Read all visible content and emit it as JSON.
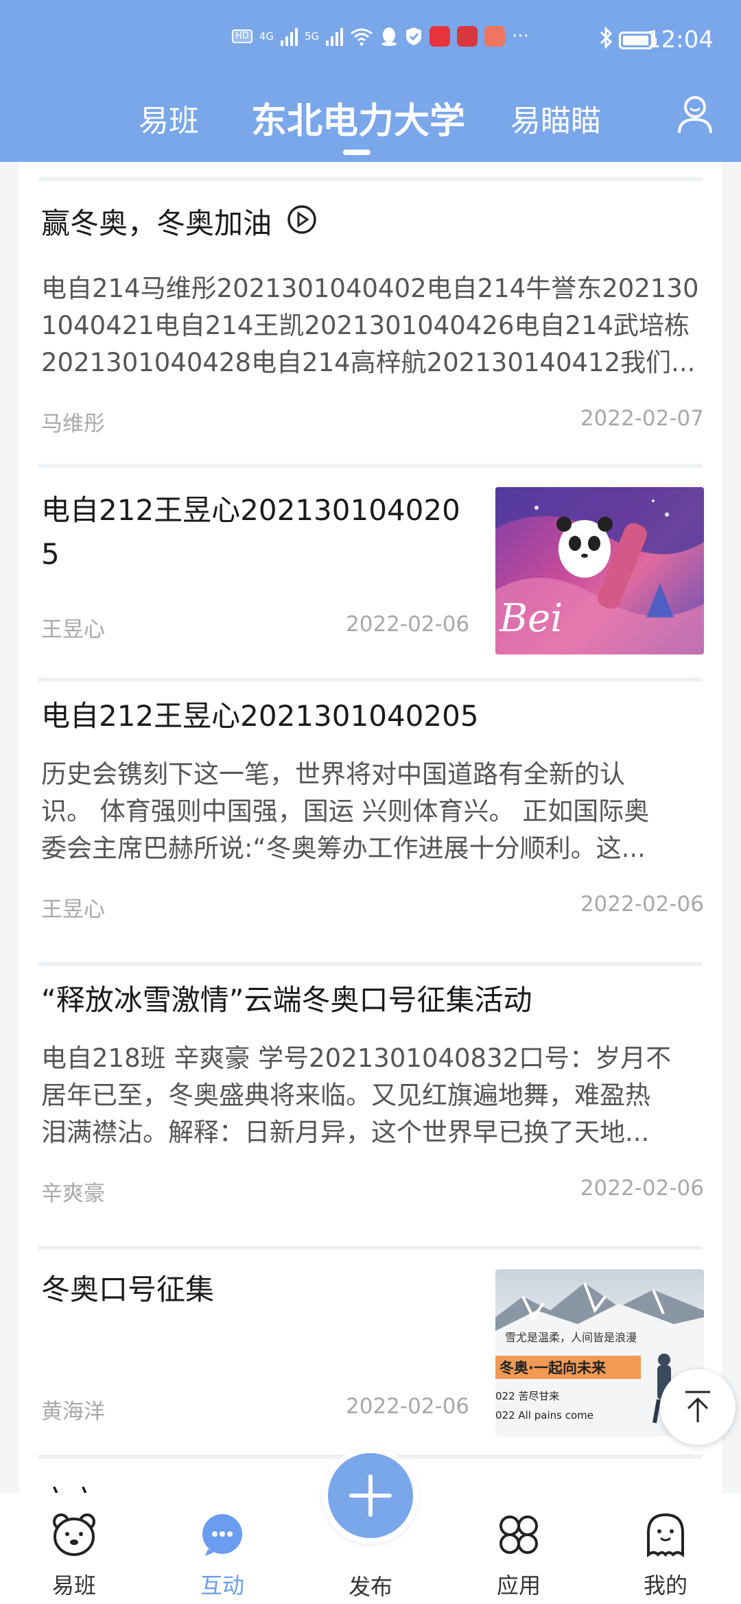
{
  "status_bar": {
    "time": "12:04",
    "network_1": "4G",
    "network_2": "5G",
    "more": "···"
  },
  "header": {
    "tabs": [
      {
        "label": "易班"
      },
      {
        "label": "东北电力大学"
      },
      {
        "label": "易瞄瞄"
      }
    ]
  },
  "feed": [
    {
      "title": "赢冬奥，冬奥加油",
      "body": [
        "电自214马维彤2021301040402电自214牛誉东202130",
        "1040421电自214王凯2021301040426电自214武培栋",
        "2021301040428电自214高梓航202130140412我们..."
      ],
      "author": "马维彤",
      "date": "2022-02-07"
    },
    {
      "title_lines": [
        "电自212王昱心202130104020",
        "5"
      ],
      "author": "王昱心",
      "date": "2022-02-06",
      "thumb_text": "Bei"
    },
    {
      "title": "电自212王昱心2021301040205",
      "body": [
        "历史会镌刻下这一笔，世界将对中国道路有全新的认",
        "识。 体育强则中国强，国运 兴则体育兴。 正如国际奥",
        "委会主席巴赫所说:“冬奥筹办工作进展十分顺利。这..."
      ],
      "author": "王昱心",
      "date": "2022-02-06"
    },
    {
      "title": "“释放冰雪激情”云端冬奥口号征集活动",
      "body": [
        "电自218班  辛爽豪  学号2021301040832口号：岁月不",
        "居年已至，冬奥盛典将来临。又见红旗遍地舞，难盈热",
        "泪满襟沾。解释：日新月异，这个世界早已换了天地..."
      ],
      "author": "辛爽豪",
      "date": "2022-02-06"
    },
    {
      "title": "冬奥口号征集",
      "author": "黄海洋",
      "date": "2022-02-06",
      "thumb_lines": [
        "雪尤是温柔，人间皆是浪漫",
        "冬奥·一起向未来",
        "022   苦尽甘来",
        "022   All pains come"
      ]
    },
    {
      "title_partial": "六六"
    }
  ],
  "bottom_nav": [
    {
      "label": "易班"
    },
    {
      "label": "互动"
    },
    {
      "label": "发布"
    },
    {
      "label": "应用"
    },
    {
      "label": "我的"
    }
  ],
  "colors": {
    "header_bg": "#7aa6ea",
    "active_nav": "#6a9cf0"
  }
}
